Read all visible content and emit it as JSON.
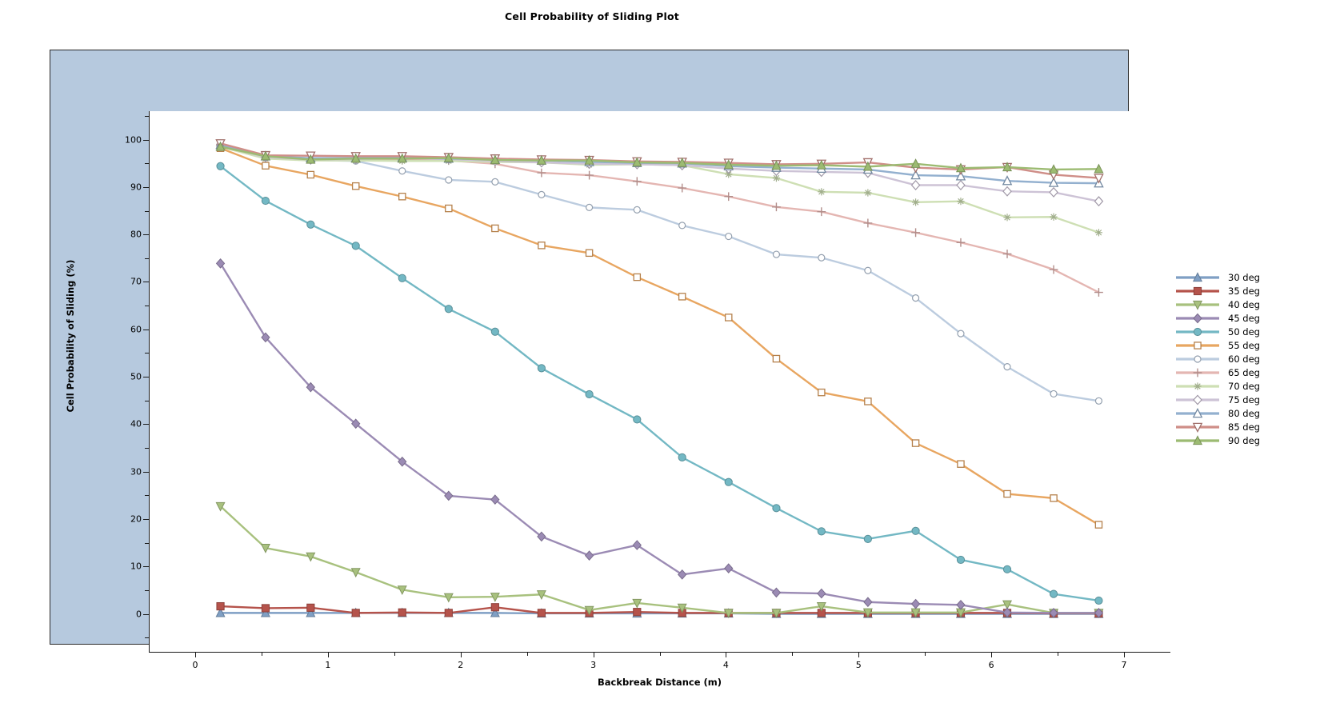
{
  "title": "Cell Probability of Sliding Plot",
  "axis": {
    "xlabel": "Backbreak Distance (m)",
    "ylabel": "Cell Probability of Sliding (%)",
    "xticks": [
      "0",
      "1",
      "2",
      "3",
      "4",
      "5",
      "6",
      "7"
    ],
    "yticks": [
      "0",
      "10",
      "20",
      "30",
      "40",
      "50",
      "60",
      "70",
      "80",
      "90",
      "100"
    ]
  },
  "legend": {
    "items": [
      {
        "label": "30 deg",
        "color": "#7f9fc4",
        "marker": "triangle-up-filled"
      },
      {
        "label": "35 deg",
        "color": "#b5534b",
        "marker": "square-filled"
      },
      {
        "label": "40 deg",
        "color": "#a8c17e",
        "marker": "triangle-down-filled"
      },
      {
        "label": "45 deg",
        "color": "#9b8bb4",
        "marker": "diamond-filled"
      },
      {
        "label": "50 deg",
        "color": "#73b8c4",
        "marker": "circle-filled"
      },
      {
        "label": "55 deg",
        "color": "#e8a661",
        "marker": "square-open"
      },
      {
        "label": "60 deg",
        "color": "#bcccdf",
        "marker": "circle-open"
      },
      {
        "label": "65 deg",
        "color": "#e4b6b2",
        "marker": "plus"
      },
      {
        "label": "70 deg",
        "color": "#cedfb4",
        "marker": "asterisk"
      },
      {
        "label": "75 deg",
        "color": "#cdc3d6",
        "marker": "diamond-open"
      },
      {
        "label": "80 deg",
        "color": "#93b0cf",
        "marker": "triangle-up-open"
      },
      {
        "label": "85 deg",
        "color": "#cf8e88",
        "marker": "triangle-down-open"
      },
      {
        "label": "90 deg",
        "color": "#9cbb72",
        "marker": "triangle-up-filled"
      }
    ]
  },
  "chart_data": {
    "type": "line",
    "title": "Cell Probability of Sliding Plot",
    "xlabel": "Backbreak Distance (m)",
    "ylabel": "Cell Probability of Sliding (%)",
    "xlim": [
      -0.35,
      7.35
    ],
    "ylim": [
      -8,
      106
    ],
    "grid": false,
    "legend_position": "right",
    "x": [
      0.19,
      0.53,
      0.87,
      1.21,
      1.56,
      1.91,
      2.26,
      2.61,
      2.97,
      3.33,
      3.67,
      4.02,
      4.38,
      4.72,
      5.07,
      5.43,
      5.77,
      6.12,
      6.47,
      6.81
    ],
    "series": [
      {
        "name": "30 deg",
        "color": "#7f9fc4",
        "marker": "triangle-up-filled",
        "values": [
          0.2,
          0.2,
          0.2,
          0.2,
          0.2,
          0.2,
          0.2,
          0.1,
          0.1,
          0.1,
          0.1,
          0.1,
          0.0,
          0.0,
          0.0,
          0.0,
          0.0,
          0.0,
          0.0,
          0.0
        ]
      },
      {
        "name": "35 deg",
        "color": "#b5534b",
        "marker": "square-filled",
        "values": [
          1.6,
          1.2,
          1.3,
          0.2,
          0.3,
          0.2,
          1.4,
          0.2,
          0.2,
          0.4,
          0.2,
          0.2,
          0.2,
          0.2,
          0.2,
          0.2,
          0.2,
          0.2,
          0.1,
          0.1
        ]
      },
      {
        "name": "40 deg",
        "color": "#a8c17e",
        "marker": "triangle-down-filled",
        "values": [
          22.7,
          13.9,
          12.1,
          8.8,
          5.1,
          3.5,
          3.6,
          4.1,
          0.8,
          2.3,
          1.3,
          0.2,
          0.2,
          1.6,
          0.3,
          0.3,
          0.3,
          2.0,
          0.2,
          0.2
        ]
      },
      {
        "name": "45 deg",
        "color": "#9b8bb4",
        "marker": "diamond-filled",
        "values": [
          73.9,
          58.3,
          47.8,
          40.1,
          32.1,
          24.9,
          24.1,
          16.3,
          12.3,
          14.5,
          8.3,
          9.6,
          4.5,
          4.3,
          2.5,
          2.1,
          1.9,
          0.3,
          0.2,
          0.2
        ]
      },
      {
        "name": "50 deg",
        "color": "#73b8c4",
        "marker": "circle-filled",
        "values": [
          94.4,
          87.1,
          82.1,
          77.6,
          70.8,
          64.3,
          59.5,
          51.8,
          46.3,
          41.0,
          33.0,
          27.8,
          22.3,
          17.4,
          15.8,
          17.5,
          11.4,
          9.4,
          4.2,
          2.8
        ]
      },
      {
        "name": "55 deg",
        "color": "#e8a661",
        "marker": "square-open",
        "values": [
          98.2,
          94.5,
          92.6,
          90.2,
          88.0,
          85.5,
          81.3,
          77.7,
          76.1,
          71.0,
          66.9,
          62.5,
          53.8,
          46.7,
          44.8,
          36.0,
          31.6,
          25.3,
          24.4,
          18.8
        ]
      },
      {
        "name": "60 deg",
        "color": "#bcccdf",
        "marker": "circle-open",
        "values": [
          98.9,
          96.2,
          95.7,
          95.5,
          93.4,
          91.5,
          91.1,
          88.4,
          85.7,
          85.2,
          81.9,
          79.6,
          75.8,
          75.1,
          72.4,
          66.6,
          59.1,
          52.1,
          46.4,
          44.9
        ]
      },
      {
        "name": "65 deg",
        "color": "#e4b6b2",
        "marker": "plus",
        "values": [
          99.0,
          96.4,
          96.0,
          95.8,
          95.8,
          95.6,
          94.9,
          93.0,
          92.5,
          91.2,
          89.8,
          88.0,
          85.8,
          84.8,
          82.4,
          80.4,
          78.3,
          75.9,
          72.6,
          67.8
        ]
      },
      {
        "name": "70 deg",
        "color": "#cedfb4",
        "marker": "asterisk",
        "values": [
          98.5,
          96.0,
          95.6,
          95.6,
          95.5,
          95.5,
          95.3,
          95.2,
          94.7,
          94.8,
          94.6,
          92.7,
          91.9,
          89.0,
          88.8,
          86.8,
          87.0,
          83.6,
          83.7,
          80.4
        ]
      },
      {
        "name": "75 deg",
        "color": "#cdc3d6",
        "marker": "diamond-open",
        "values": [
          98.7,
          96.3,
          95.8,
          95.9,
          96.1,
          95.9,
          95.5,
          95.2,
          94.9,
          94.8,
          94.6,
          93.9,
          93.4,
          93.2,
          93.0,
          90.4,
          90.4,
          89.1,
          88.9,
          87.0
        ]
      },
      {
        "name": "80 deg",
        "color": "#93b0cf",
        "marker": "triangle-up-open",
        "values": [
          98.9,
          96.5,
          96.1,
          96.1,
          96.2,
          96.0,
          95.8,
          95.6,
          95.3,
          95.1,
          95.0,
          94.4,
          94.1,
          93.9,
          93.7,
          92.5,
          92.3,
          91.3,
          90.9,
          90.8
        ]
      },
      {
        "name": "85 deg",
        "color": "#cf8e88",
        "marker": "triangle-down-open",
        "values": [
          99.2,
          96.7,
          96.6,
          96.5,
          96.5,
          96.3,
          96.0,
          95.8,
          95.7,
          95.4,
          95.3,
          95.1,
          94.8,
          94.9,
          95.2,
          94.1,
          93.7,
          94.2,
          92.6,
          91.9
        ]
      },
      {
        "name": "90 deg",
        "color": "#9cbb72",
        "marker": "triangle-up-filled",
        "values": [
          98.5,
          96.5,
          95.8,
          96.0,
          96.0,
          96.1,
          95.7,
          95.6,
          95.6,
          95.2,
          95.1,
          94.7,
          94.5,
          94.6,
          94.3,
          94.9,
          94.0,
          94.2,
          93.7,
          93.8
        ]
      }
    ]
  }
}
